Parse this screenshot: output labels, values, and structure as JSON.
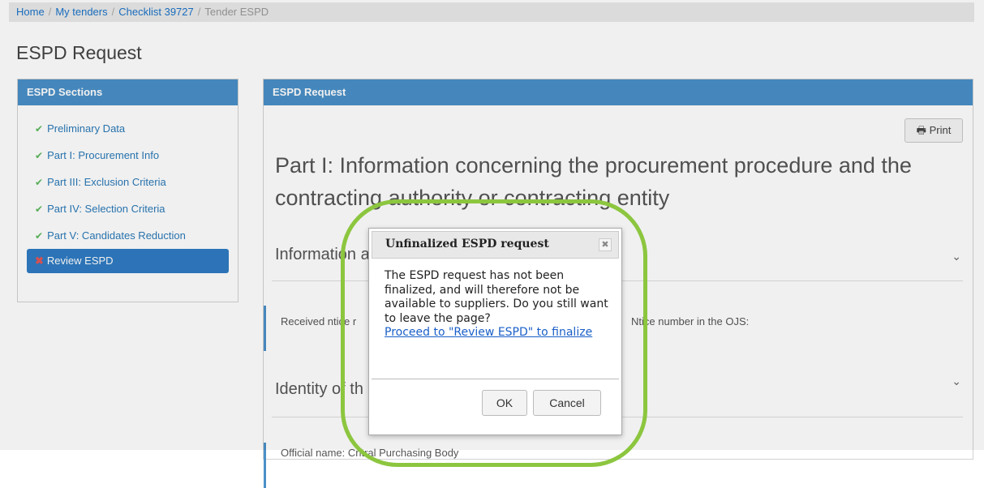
{
  "breadcrumb": {
    "items": [
      "Home",
      "My tenders",
      "Checklist 39727"
    ],
    "current": "Tender ESPD"
  },
  "page_title": "ESPD Request",
  "sidebar": {
    "header": "ESPD Sections",
    "items": [
      {
        "label": "Preliminary Data",
        "status": "done"
      },
      {
        "label": "Part I: Procurement Info",
        "status": "done"
      },
      {
        "label": "Part III: Exclusion Criteria",
        "status": "done"
      },
      {
        "label": "Part IV: Selection Criteria",
        "status": "done"
      },
      {
        "label": "Part V: Candidates Reduction",
        "status": "done"
      },
      {
        "label": "Review ESPD",
        "status": "error"
      }
    ]
  },
  "main": {
    "header": "ESPD Request",
    "print_label": "Print",
    "heading": "Part I: Information concerning the procurement procedure and the contracting authority or contracting entity",
    "section1_title": "Information a",
    "section1_field_left": "Received n​tice r",
    "section1_field_right": "N​tice number in the OJS:",
    "section2_title": "Identity of th",
    "section2_field": "Official name: C​ntral Purchasing Body"
  },
  "dialog": {
    "title": "Unfinalized ESPD request",
    "message": "The ESPD request has not been finalized, and will therefore not be available to suppliers. Do you still want to leave the page?",
    "link": "Proceed to \"Review ESPD\" to finalize",
    "ok_label": "OK",
    "cancel_label": "Cancel"
  },
  "colors": {
    "accent": "#4a90c8",
    "highlight": "#8cc63f",
    "check": "#5cb85c",
    "error": "#e35555"
  }
}
